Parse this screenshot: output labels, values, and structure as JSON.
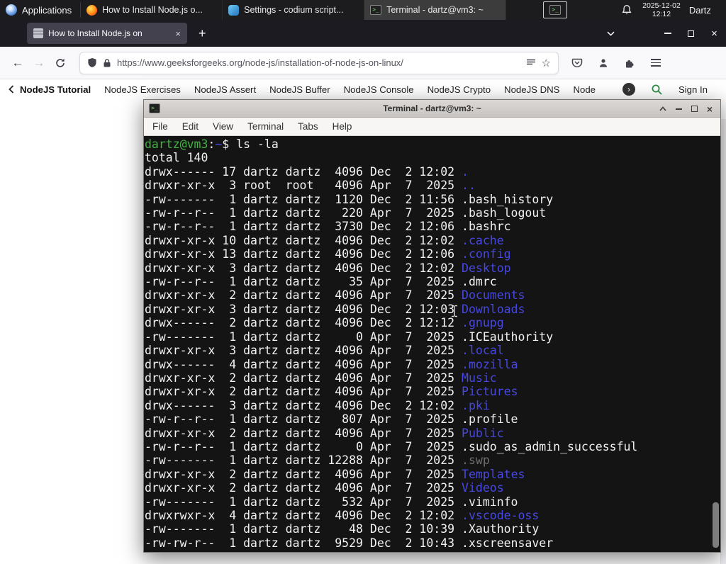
{
  "panel": {
    "applications_label": "Applications",
    "windows": [
      {
        "title": "How to Install Node.js o...",
        "icon": "firefox"
      },
      {
        "title": "Settings - codium script...",
        "icon": "codium"
      },
      {
        "title": "Terminal - dartz@vm3: ~",
        "icon": "terminal"
      }
    ],
    "clock_date": "2025-12-02",
    "clock_time": "12:12",
    "user": "Dartz"
  },
  "browser": {
    "tab_title": "How to Install Node.js on",
    "new_tab_label": "+",
    "url": "https://www.geeksforgeeks.org/node-js/installation-of-node-js-on-linux/",
    "site_nav": {
      "items": [
        "NodeJS Tutorial",
        "NodeJS Exercises",
        "NodeJS Assert",
        "NodeJS Buffer",
        "NodeJS Console",
        "NodeJS Crypto",
        "NodeJS DNS",
        "Node"
      ],
      "sign_in": "Sign In"
    }
  },
  "terminal_window": {
    "title": "Terminal - dartz@vm3: ~",
    "menu_items": [
      "File",
      "Edit",
      "View",
      "Terminal",
      "Tabs",
      "Help"
    ],
    "palette": {
      "f": "#f2f2f2",
      "g": "#3fb440",
      "b": "#4747e2",
      "d": "#6f6f6f",
      "bg": "#141414"
    },
    "lines": [
      [
        [
          "dartz@vm3",
          "g"
        ],
        [
          ":",
          "f"
        ],
        [
          "~",
          "b"
        ],
        [
          "$ ls -la",
          "f"
        ]
      ],
      [
        [
          "total 140",
          "f"
        ]
      ],
      [
        [
          "drwx------ 17 dartz dartz  4096 Dec  2 12:02 ",
          "f"
        ],
        [
          ".",
          "b"
        ]
      ],
      [
        [
          "drwxr-xr-x  3 root  root   4096 Apr  7  2025 ",
          "f"
        ],
        [
          "..",
          "b"
        ]
      ],
      [
        [
          "-rw-------  1 dartz dartz  1120 Dec  2 11:56 .bash_history",
          "f"
        ]
      ],
      [
        [
          "-rw-r--r--  1 dartz dartz   220 Apr  7  2025 .bash_logout",
          "f"
        ]
      ],
      [
        [
          "-rw-r--r--  1 dartz dartz  3730 Dec  2 12:06 .bashrc",
          "f"
        ]
      ],
      [
        [
          "drwxr-xr-x 10 dartz dartz  4096 Dec  2 12:02 ",
          "f"
        ],
        [
          ".cache",
          "b"
        ]
      ],
      [
        [
          "drwxr-xr-x 13 dartz dartz  4096 Dec  2 12:06 ",
          "f"
        ],
        [
          ".config",
          "b"
        ]
      ],
      [
        [
          "drwxr-xr-x  3 dartz dartz  4096 Dec  2 12:02 ",
          "f"
        ],
        [
          "Desktop",
          "b"
        ]
      ],
      [
        [
          "-rw-r--r--  1 dartz dartz    35 Apr  7  2025 .dmrc",
          "f"
        ]
      ],
      [
        [
          "drwxr-xr-x  2 dartz dartz  4096 Apr  7  2025 ",
          "f"
        ],
        [
          "Documents",
          "b"
        ]
      ],
      [
        [
          "drwxr-xr-x  3 dartz dartz  4096 Dec  2 12:03 ",
          "f"
        ],
        [
          "Downloads",
          "b"
        ]
      ],
      [
        [
          "drwx------  2 dartz dartz  4096 Dec  2 12:12 ",
          "f"
        ],
        [
          ".gnupg",
          "b"
        ]
      ],
      [
        [
          "-rw-------  1 dartz dartz     0 Apr  7  2025 .ICEauthority",
          "f"
        ]
      ],
      [
        [
          "drwxr-xr-x  3 dartz dartz  4096 Apr  7  2025 ",
          "f"
        ],
        [
          ".local",
          "b"
        ]
      ],
      [
        [
          "drwx------  4 dartz dartz  4096 Apr  7  2025 ",
          "f"
        ],
        [
          ".mozilla",
          "b"
        ]
      ],
      [
        [
          "drwxr-xr-x  2 dartz dartz  4096 Apr  7  2025 ",
          "f"
        ],
        [
          "Music",
          "b"
        ]
      ],
      [
        [
          "drwxr-xr-x  2 dartz dartz  4096 Apr  7  2025 ",
          "f"
        ],
        [
          "Pictures",
          "b"
        ]
      ],
      [
        [
          "drwx------  3 dartz dartz  4096 Dec  2 12:02 ",
          "f"
        ],
        [
          ".pki",
          "b"
        ]
      ],
      [
        [
          "-rw-r--r--  1 dartz dartz   807 Apr  7  2025 .profile",
          "f"
        ]
      ],
      [
        [
          "drwxr-xr-x  2 dartz dartz  4096 Apr  7  2025 ",
          "f"
        ],
        [
          "Public",
          "b"
        ]
      ],
      [
        [
          "-rw-r--r--  1 dartz dartz     0 Apr  7  2025 .sudo_as_admin_successful",
          "f"
        ]
      ],
      [
        [
          "-rw-------  1 dartz dartz 12288 Apr  7  2025 ",
          "f"
        ],
        [
          ".swp",
          "d"
        ]
      ],
      [
        [
          "drwxr-xr-x  2 dartz dartz  4096 Apr  7  2025 ",
          "f"
        ],
        [
          "Templates",
          "b"
        ]
      ],
      [
        [
          "drwxr-xr-x  2 dartz dartz  4096 Apr  7  2025 ",
          "f"
        ],
        [
          "Videos",
          "b"
        ]
      ],
      [
        [
          "-rw-------  1 dartz dartz   532 Apr  7  2025 .viminfo",
          "f"
        ]
      ],
      [
        [
          "drwxrwxr-x  4 dartz dartz  4096 Dec  2 12:02 ",
          "f"
        ],
        [
          ".vscode-oss",
          "b"
        ]
      ],
      [
        [
          "-rw-------  1 dartz dartz    48 Dec  2 10:39 .Xauthority",
          "f"
        ]
      ],
      [
        [
          "-rw-rw-r--  1 dartz dartz  9529 Dec  2 10:43 .xscreensaver",
          "f"
        ]
      ]
    ]
  }
}
